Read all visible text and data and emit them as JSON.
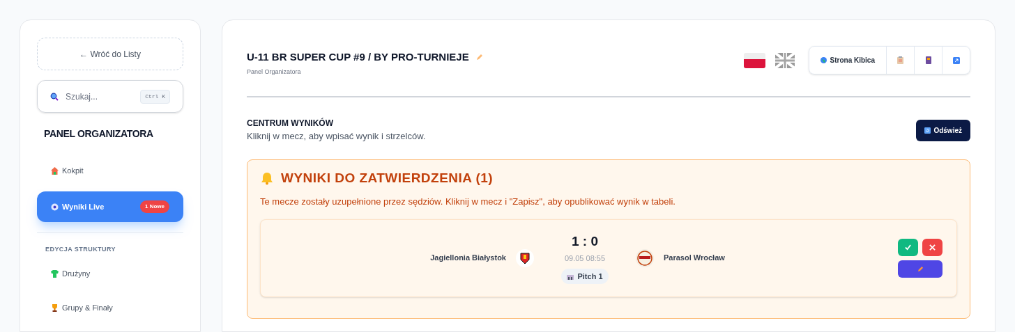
{
  "sidebar": {
    "back_button": "← Wróć do Listy",
    "search": {
      "placeholder": "Szukaj...",
      "shortcut": "Ctrl K"
    },
    "title": "PANEL ORGANIZATORA",
    "items": [
      {
        "label": "Kokpit",
        "kind": "house",
        "selected": false
      },
      {
        "label": "Wyniki Live",
        "kind": "ball",
        "selected": true,
        "badge": "1 Nowe"
      }
    ],
    "section": {
      "title": "EDYCJA STRUKTURY",
      "items": [
        {
          "label": "Drużyny",
          "kind": "shirt",
          "selected": false
        },
        {
          "label": "Grupy & Finały",
          "kind": "trophy",
          "selected": false
        }
      ]
    }
  },
  "header": {
    "title": "U-11 BR SUPER CUP #9 / BY PRO-TURNIEJE",
    "subtitle": "Panel Organizatora",
    "languages": [
      {
        "kind": "pl",
        "selected": true
      },
      {
        "kind": "gb",
        "selected": false
      }
    ],
    "fan_page_button": "Strona Kibica"
  },
  "results": {
    "title": "CENTRUM WYNIKÓW",
    "subtitle": "Kliknij w mecz, aby wpisać wynik i strzelców.",
    "refresh_button": "Odśwież",
    "pending": {
      "title": "WYNIKI DO ZATWIERDZENIA (1)",
      "description": "Te mecze zostały uzupełnione przez sędziów. Kliknij w mecz i \"Zapisz\", aby opublikować wynik w tabeli.",
      "matches": [
        {
          "home": "Jagiellonia Białystok",
          "away": "Parasol Wrocław",
          "score": "1 : 0",
          "time": "09.05 08:55",
          "pitch": "Pitch 1"
        }
      ]
    }
  }
}
